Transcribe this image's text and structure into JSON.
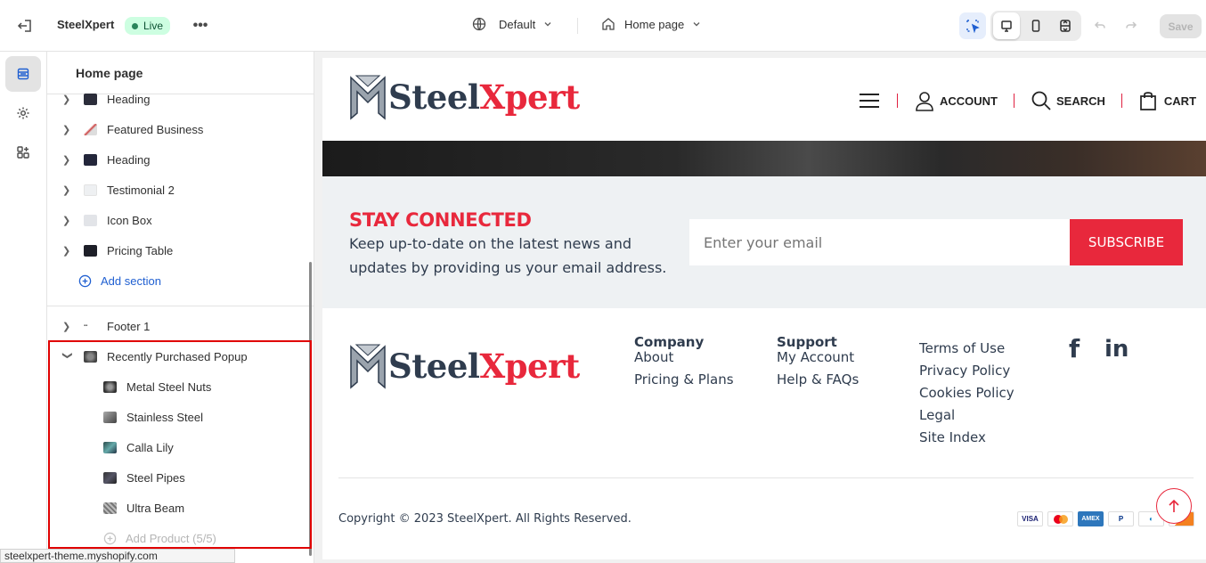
{
  "topbar": {
    "store_name": "SteelXpert",
    "status": "Live",
    "theme_selector": "Default",
    "page_selector": "Home page",
    "save_label": "Save"
  },
  "panel": {
    "title": "Home page",
    "sections": [
      {
        "label": "Heading"
      },
      {
        "label": "Featured Business"
      },
      {
        "label": "Heading"
      },
      {
        "label": "Testimonial 2"
      },
      {
        "label": "Icon Box"
      },
      {
        "label": "Pricing Table"
      }
    ],
    "add_section": "Add section",
    "footer_label": "Footer 1",
    "popup": {
      "label": "Recently Purchased Popup",
      "blocks": [
        "Metal Steel Nuts",
        "Stainless Steel",
        "Calla Lily",
        "Steel Pipes",
        "Ultra Beam"
      ],
      "add_product": "Add Product (5/5)"
    }
  },
  "statusbar": {
    "url": "steelxpert-theme.myshopify.com"
  },
  "preview": {
    "logo": {
      "part1": "Steel",
      "part2": "Xpert"
    },
    "nav": {
      "account": "ACCOUNT",
      "search": "SEARCH",
      "cart": "CART"
    },
    "newsletter": {
      "title": "STAY CONNECTED",
      "text_line1": "Keep up-to-date on the latest news and",
      "text_line2": "updates by providing us your email address.",
      "placeholder": "Enter your email",
      "button": "SUBSCRIBE"
    },
    "footer": {
      "col1": {
        "heading": "Company",
        "links": [
          "About",
          "Pricing & Plans"
        ]
      },
      "col2": {
        "heading": "Support",
        "links": [
          "My Account",
          "Help & FAQs"
        ]
      },
      "col3": {
        "links": [
          "Terms of Use",
          "Privacy Policy",
          "Cookies Policy",
          "Legal",
          "Site Index"
        ]
      },
      "social": {
        "facebook": "f",
        "linkedin": "in"
      },
      "copyright": "Copyright © 2023 SteelXpert. All Rights Reserved.",
      "payments": [
        "VISA",
        "",
        "AMEX",
        "P",
        "",
        ""
      ]
    }
  },
  "colors": {
    "brand_red": "#e8283c",
    "brand_navy": "#2f3c4e",
    "live_green": "#29845a"
  }
}
